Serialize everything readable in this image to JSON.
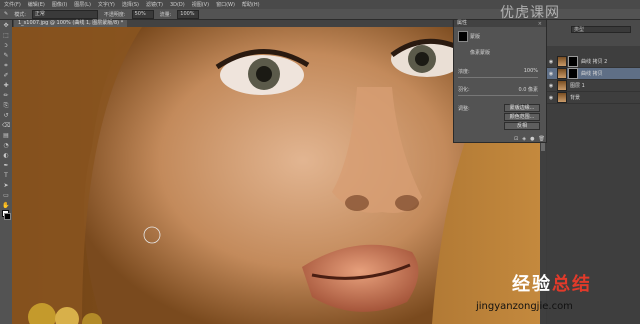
{
  "menubar": {
    "items": [
      "文件(F)",
      "编辑(E)",
      "图像(I)",
      "图层(L)",
      "文字(Y)",
      "选择(S)",
      "滤镜(T)",
      "3D(D)",
      "视图(V)",
      "窗口(W)",
      "帮助(H)"
    ]
  },
  "options": {
    "mode_label": "模式:",
    "mode_value": "正常",
    "opacity_label": "不透明度:",
    "opacity_value": "50%",
    "flow_label": "流量:",
    "flow_value": "100%"
  },
  "document": {
    "tab_title": "1_s1007.jpg @ 100% (曲线 1, 图层蒙版/8) *"
  },
  "toolbar": {
    "icons": [
      "move-icon",
      "marquee-icon",
      "lasso-icon",
      "quick-select-icon",
      "crop-icon",
      "eyedropper-icon",
      "healing-icon",
      "brush-icon",
      "stamp-icon",
      "history-brush-icon",
      "eraser-icon",
      "gradient-icon",
      "blur-icon",
      "dodge-icon",
      "pen-icon",
      "type-icon",
      "path-select-icon",
      "shape-icon",
      "hand-icon",
      "zoom-icon"
    ],
    "glyphs": [
      "✥",
      "⬚",
      "ↄ",
      "✎",
      "⌗",
      "✐",
      "✚",
      "✏",
      "⎘",
      "↺",
      "⌫",
      "▤",
      "◔",
      "◐",
      "✒",
      "T",
      "➤",
      "▭",
      "✋",
      "⌕"
    ]
  },
  "properties": {
    "tab_label": "属性",
    "mask_label": "蒙版",
    "pixel_mask_label": "像素蒙版",
    "density_label": "浓度:",
    "density_value": "100%",
    "feather_label": "羽化:",
    "feather_value": "0.0 像素",
    "refine_label": "调整:",
    "btn_mask_edge": "蒙版边缘...",
    "btn_color_range": "颜色范围...",
    "btn_invert": "反相",
    "bottom_icons": [
      "⊡",
      "◈",
      "●",
      "🗑"
    ]
  },
  "layers": {
    "search_placeholder": "类型",
    "items": [
      {
        "name": "曲线 拷贝 2",
        "selected": false
      },
      {
        "name": "曲线 拷贝",
        "selected": true
      },
      {
        "name": "图层 1",
        "selected": false
      },
      {
        "name": "背景",
        "selected": false
      }
    ]
  },
  "watermarks": {
    "top_right": "优虎课网",
    "bottom_brand_a": "经验",
    "bottom_brand_b": "总结",
    "bottom_url": "jingyanzongjie.com"
  },
  "colors": {
    "panel": "#535353",
    "selected_layer": "#5f6f86",
    "watermark_red": "#e23a2a"
  }
}
